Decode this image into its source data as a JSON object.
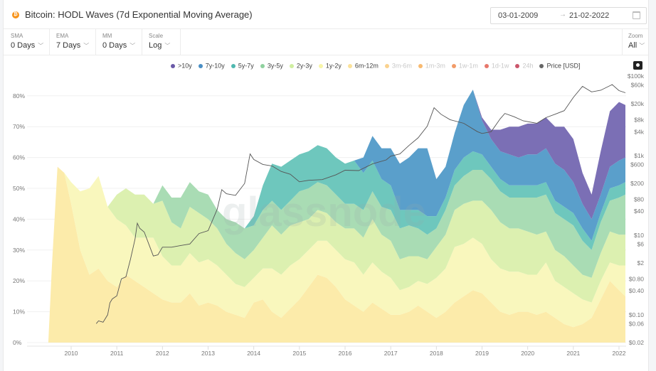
{
  "header": {
    "title": "Bitcoin: HODL Waves (7d Exponential Moving Average)",
    "asset_icon": "bitcoin-icon",
    "date_from": "03-01-2009",
    "date_arrow": "→",
    "date_to": "21-02-2022",
    "calendar_icon": "calendar-icon"
  },
  "controls": [
    {
      "label": "SMA",
      "value": "0 Days"
    },
    {
      "label": "EMA",
      "value": "7 Days"
    },
    {
      "label": "MM",
      "value": "0 Days"
    },
    {
      "label": "Scale",
      "value": "Log"
    }
  ],
  "zoom": {
    "label": "Zoom",
    "value": "All"
  },
  "watermark": "glassnode",
  "legend": [
    {
      "label": ">10y",
      "color": "#6a5aa8",
      "active": true
    },
    {
      "label": "7y-10y",
      "color": "#4a8fc4",
      "active": true
    },
    {
      "label": "5y-7y",
      "color": "#4fb8b0",
      "active": true
    },
    {
      "label": "3y-5y",
      "color": "#8fd19e",
      "active": true
    },
    {
      "label": "2y-3y",
      "color": "#cfeea0",
      "active": true
    },
    {
      "label": "1y-2y",
      "color": "#f7f5a8",
      "active": true
    },
    {
      "label": "6m-12m",
      "color": "#fbe29a",
      "active": true
    },
    {
      "label": "3m-6m",
      "color": "#f8c36a",
      "active": false
    },
    {
      "label": "1m-3m",
      "color": "#f5a340",
      "active": false
    },
    {
      "label": "1w-1m",
      "color": "#ee7a35",
      "active": false
    },
    {
      "label": "1d-1w",
      "color": "#df4a3a",
      "active": false
    },
    {
      "label": "24h",
      "color": "#b81d3a",
      "active": false
    },
    {
      "label": "Price [USD]",
      "color": "#666666",
      "active": true
    }
  ],
  "chart_data": {
    "type": "area",
    "stacked": true,
    "title": "Bitcoin: HODL Waves (7d Exponential Moving Average)",
    "xlabel": "",
    "ylabel": "",
    "x_range": [
      2009.0,
      2022.15
    ],
    "y_range_pct": [
      0,
      85
    ],
    "y_ticks_pct": [
      "0%",
      "10%",
      "20%",
      "30%",
      "40%",
      "50%",
      "60%",
      "70%",
      "80%"
    ],
    "x_ticks": [
      "2010",
      "2011",
      "2012",
      "2013",
      "2014",
      "2015",
      "2016",
      "2017",
      "2018",
      "2019",
      "2020",
      "2021",
      "2022"
    ],
    "y2_scale": "log",
    "y2_range_usd": [
      0.02,
      100000
    ],
    "y2_ticks": [
      {
        "label": "$100k",
        "value": 100000
      },
      {
        "label": "$60k",
        "value": 60000
      },
      {
        "label": "$20k",
        "value": 20000
      },
      {
        "label": "$8k",
        "value": 8000
      },
      {
        "label": "$4k",
        "value": 4000
      },
      {
        "label": "$1k",
        "value": 1000
      },
      {
        "label": "$600",
        "value": 600
      },
      {
        "label": "$200",
        "value": 200
      },
      {
        "label": "$80",
        "value": 80
      },
      {
        "label": "$40",
        "value": 40
      },
      {
        "label": "$10",
        "value": 10
      },
      {
        "label": "$6",
        "value": 6
      },
      {
        "label": "$2",
        "value": 2
      },
      {
        "label": "$0.80",
        "value": 0.8
      },
      {
        "label": "$0.40",
        "value": 0.4
      },
      {
        "label": "$0.10",
        "value": 0.1
      },
      {
        "label": "$0.06",
        "value": 0.06
      },
      {
        "label": "$0.02",
        "value": 0.02
      }
    ],
    "x": [
      2009.5,
      2009.58,
      2009.7,
      2009.85,
      2010.0,
      2010.2,
      2010.4,
      2010.6,
      2010.8,
      2011.0,
      2011.2,
      2011.4,
      2011.6,
      2011.8,
      2012.0,
      2012.2,
      2012.4,
      2012.6,
      2012.8,
      2013.0,
      2013.2,
      2013.4,
      2013.6,
      2013.8,
      2014.0,
      2014.2,
      2014.4,
      2014.6,
      2014.8,
      2015.0,
      2015.2,
      2015.4,
      2015.6,
      2015.8,
      2016.0,
      2016.2,
      2016.4,
      2016.6,
      2016.8,
      2017.0,
      2017.2,
      2017.4,
      2017.6,
      2017.8,
      2018.0,
      2018.2,
      2018.4,
      2018.6,
      2018.8,
      2019.0,
      2019.2,
      2019.4,
      2019.6,
      2019.8,
      2020.0,
      2020.2,
      2020.4,
      2020.6,
      2020.8,
      2021.0,
      2021.2,
      2021.4,
      2021.6,
      2021.8,
      2022.0,
      2022.14
    ],
    "series": [
      {
        "name": "6m-12m",
        "values": [
          0,
          25,
          57,
          55,
          45,
          30,
          22,
          24,
          20,
          18,
          22,
          20,
          18,
          16,
          14,
          13,
          13,
          16,
          12,
          13,
          12,
          10,
          9,
          8,
          13,
          14,
          10,
          8,
          11,
          14,
          18,
          22,
          21,
          18,
          14,
          12,
          10,
          13,
          11,
          9,
          9,
          10,
          12,
          10,
          8,
          10,
          13,
          15,
          17,
          16,
          13,
          10,
          9,
          10,
          10,
          9,
          10,
          8,
          6,
          5,
          6,
          8,
          14,
          20,
          17,
          15
        ]
      },
      {
        "name": "1y-2y",
        "values": [
          0,
          0,
          0,
          0,
          7,
          19,
          28,
          30,
          24,
          22,
          16,
          14,
          16,
          18,
          14,
          12,
          12,
          13,
          14,
          14,
          13,
          12,
          10,
          10,
          8,
          10,
          14,
          14,
          14,
          13,
          12,
          11,
          12,
          12,
          13,
          14,
          12,
          13,
          12,
          12,
          8,
          8,
          8,
          9,
          13,
          14,
          18,
          17,
          17,
          16,
          14,
          14,
          14,
          13,
          12,
          13,
          16,
          12,
          12,
          11,
          8,
          5,
          6,
          6,
          8,
          10
        ]
      },
      {
        "name": "2y-3y",
        "values": [
          0,
          0,
          0,
          0,
          0,
          0,
          0,
          0,
          0,
          8,
          12,
          14,
          14,
          11,
          18,
          14,
          12,
          15,
          16,
          13,
          12,
          10,
          10,
          9,
          9,
          10,
          14,
          13,
          13,
          12,
          10,
          10,
          9,
          9,
          10,
          11,
          12,
          14,
          12,
          12,
          10,
          10,
          8,
          8,
          10,
          11,
          12,
          13,
          12,
          14,
          16,
          15,
          14,
          14,
          14,
          13,
          10,
          10,
          10,
          9,
          8,
          8,
          9,
          10,
          10,
          10
        ]
      },
      {
        "name": "3y-5y",
        "values": [
          0,
          0,
          0,
          0,
          0,
          0,
          0,
          0,
          0,
          0,
          0,
          0,
          0,
          0,
          5,
          8,
          10,
          8,
          7,
          8,
          6,
          8,
          10,
          10,
          8,
          9,
          8,
          8,
          8,
          10,
          10,
          9,
          9,
          9,
          8,
          8,
          9,
          9,
          9,
          10,
          10,
          10,
          9,
          8,
          6,
          8,
          8,
          9,
          10,
          10,
          10,
          10,
          10,
          10,
          11,
          12,
          12,
          12,
          12,
          13,
          11,
          9,
          10,
          10,
          12,
          13
        ]
      },
      {
        "name": "5y-7y",
        "values": [
          0,
          0,
          0,
          0,
          0,
          0,
          0,
          0,
          0,
          0,
          0,
          0,
          0,
          0,
          0,
          0,
          0,
          0,
          0,
          0,
          0,
          0,
          0,
          0,
          3,
          8,
          12,
          14,
          13,
          12,
          12,
          12,
          12,
          12,
          13,
          14,
          12,
          10,
          9,
          8,
          6,
          5,
          6,
          6,
          4,
          4,
          5,
          6,
          6,
          5,
          4,
          4,
          4,
          4,
          4,
          4,
          4,
          4,
          4,
          4,
          4,
          3,
          3,
          4,
          4,
          4
        ]
      },
      {
        "name": "7y-10y",
        "values": [
          0,
          0,
          0,
          0,
          0,
          0,
          0,
          0,
          0,
          0,
          0,
          0,
          0,
          0,
          0,
          0,
          0,
          0,
          0,
          0,
          0,
          0,
          0,
          0,
          0,
          0,
          0,
          0,
          0,
          0,
          0,
          0,
          0,
          0,
          0,
          0,
          5,
          8,
          10,
          12,
          15,
          17,
          20,
          22,
          12,
          10,
          12,
          17,
          20,
          11,
          9,
          9,
          10,
          9,
          10,
          10,
          11,
          12,
          12,
          10,
          8,
          7,
          6,
          7,
          8,
          8
        ]
      },
      {
        "name": ">10y",
        "values": [
          0,
          0,
          0,
          0,
          0,
          0,
          0,
          0,
          0,
          0,
          0,
          0,
          0,
          0,
          0,
          0,
          0,
          0,
          0,
          0,
          0,
          0,
          0,
          0,
          0,
          0,
          0,
          0,
          0,
          0,
          0,
          0,
          0,
          0,
          0,
          0,
          0,
          0,
          0,
          0,
          0,
          0,
          0,
          0,
          0,
          0,
          0,
          0,
          0,
          1,
          3,
          7,
          9,
          10,
          10,
          10,
          10,
          12,
          14,
          14,
          10,
          8,
          14,
          18,
          19,
          17
        ]
      }
    ],
    "price": {
      "name": "Price [USD]",
      "x": [
        2010.55,
        2010.6,
        2010.7,
        2010.8,
        2010.85,
        2010.9,
        2011.0,
        2011.1,
        2011.2,
        2011.3,
        2011.4,
        2011.45,
        2011.5,
        2011.6,
        2011.7,
        2011.8,
        2011.9,
        2012.0,
        2012.2,
        2012.4,
        2012.6,
        2012.8,
        2013.0,
        2013.2,
        2013.3,
        2013.4,
        2013.6,
        2013.8,
        2013.92,
        2014.0,
        2014.2,
        2014.4,
        2014.6,
        2014.8,
        2015.0,
        2015.2,
        2015.5,
        2015.8,
        2016.0,
        2016.3,
        2016.6,
        2016.9,
        2017.0,
        2017.2,
        2017.4,
        2017.6,
        2017.8,
        2017.95,
        2018.1,
        2018.3,
        2018.6,
        2018.9,
        2019.0,
        2019.2,
        2019.4,
        2019.5,
        2019.7,
        2019.9,
        2020.2,
        2020.4,
        2020.6,
        2020.8,
        2021.0,
        2021.2,
        2021.4,
        2021.6,
        2021.85,
        2022.0,
        2022.14
      ],
      "values": [
        0.06,
        0.07,
        0.065,
        0.1,
        0.2,
        0.25,
        0.3,
        0.8,
        0.9,
        2.5,
        8,
        20,
        15,
        12,
        6,
        3,
        3.2,
        5,
        5,
        5.5,
        6,
        11,
        13,
        45,
        140,
        110,
        100,
        200,
        1100,
        800,
        600,
        550,
        400,
        340,
        220,
        240,
        250,
        330,
        430,
        420,
        620,
        780,
        970,
        1100,
        1800,
        2800,
        5500,
        16000,
        11000,
        8000,
        6500,
        4000,
        3600,
        4000,
        8500,
        11500,
        9500,
        7500,
        6500,
        9000,
        11000,
        13500,
        29000,
        55000,
        40000,
        44000,
        61000,
        43000,
        38000
      ]
    }
  }
}
